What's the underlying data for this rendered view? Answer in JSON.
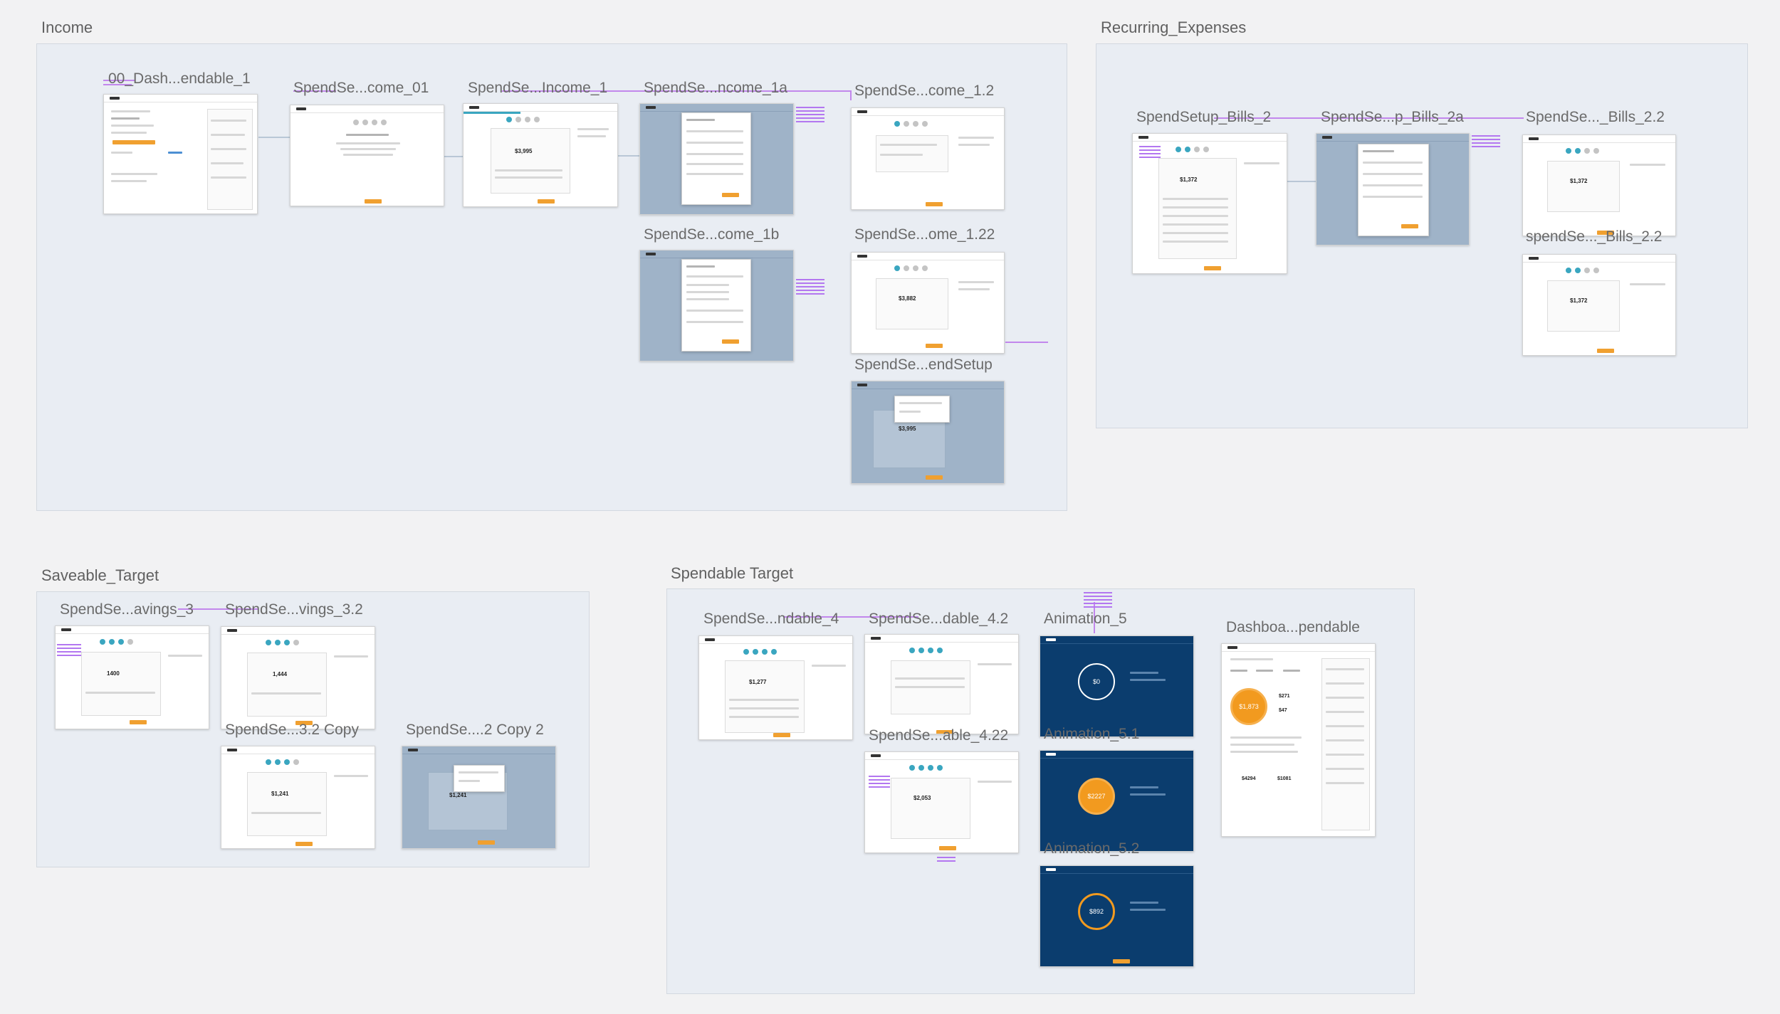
{
  "groups": {
    "income": "Income",
    "recurring": "Recurring_Expenses",
    "saveable": "Saveable_Target",
    "spendable": "Spendable Target"
  },
  "artboards": {
    "dash_spendable_1": "00_Dash...endable_1",
    "income_01": "SpendSe...come_01",
    "income_1": "SpendSe...Income_1",
    "income_1a": "SpendSe...ncome_1a",
    "income_1_2": "SpendSe...come_1.2",
    "income_1b": "SpendSe...come_1b",
    "income_1_22": "SpendSe...ome_1.22",
    "end_setup": "SpendSe...endSetup",
    "bills_2": "SpendSetup_Bills_2",
    "bills_2a": "SpendSe...p_Bills_2a",
    "bills_2_2": "SpendSe..._Bills_2.2",
    "bills_2_2b": "spendSe..._Bills_2.2",
    "savings_3": "SpendSe...avings_3",
    "savings_3_2": "SpendSe...vings_3.2",
    "savings_3_2_copy": "SpendSe...3.2 Copy",
    "savings_2_copy_2": "SpendSe....2 Copy 2",
    "spendable_4": "SpendSe...ndable_4",
    "spendable_4_2": "SpendSe...dable_4.2",
    "spendable_4_22": "SpendSe...able_4.22",
    "animation_5": "Animation_5",
    "animation_5_1": "Animation_5.1",
    "animation_5_2": "Animation_5.2",
    "dashboard_spendable": "Dashboa...pendable"
  },
  "values": {
    "income_1_total": "$3,995",
    "income_1_2_total": "$3,882",
    "end_setup_total": "$3,995",
    "bills_2_total": "$1,372",
    "bills_2_2_total": "$1,372",
    "bills_2_2b_total": "$1,372",
    "savings_3_total": "1400",
    "savings_3_2_total": "1,444",
    "savings_copy_total": "$1,241",
    "savings_copy2_total": "$1,241",
    "spendable_4_total": "$1,277",
    "spendable_4_22_total": "$2,053",
    "anim_5_value": "$0",
    "anim_5_1_value": "$2227",
    "anim_5_2_value": "$892",
    "dash_value": "$1,873",
    "dash_side_a": "$271",
    "dash_side_b": "$47",
    "dash_bottom_a": "$4294",
    "dash_bottom_b": "$1081"
  },
  "colors": {
    "accent_orange": "#f0a030",
    "progress_teal": "#3aa6c0",
    "dark_navy": "#0b3d6e",
    "overlay_blue": "#9fb3c8",
    "connector_purple": "#c287ec"
  }
}
